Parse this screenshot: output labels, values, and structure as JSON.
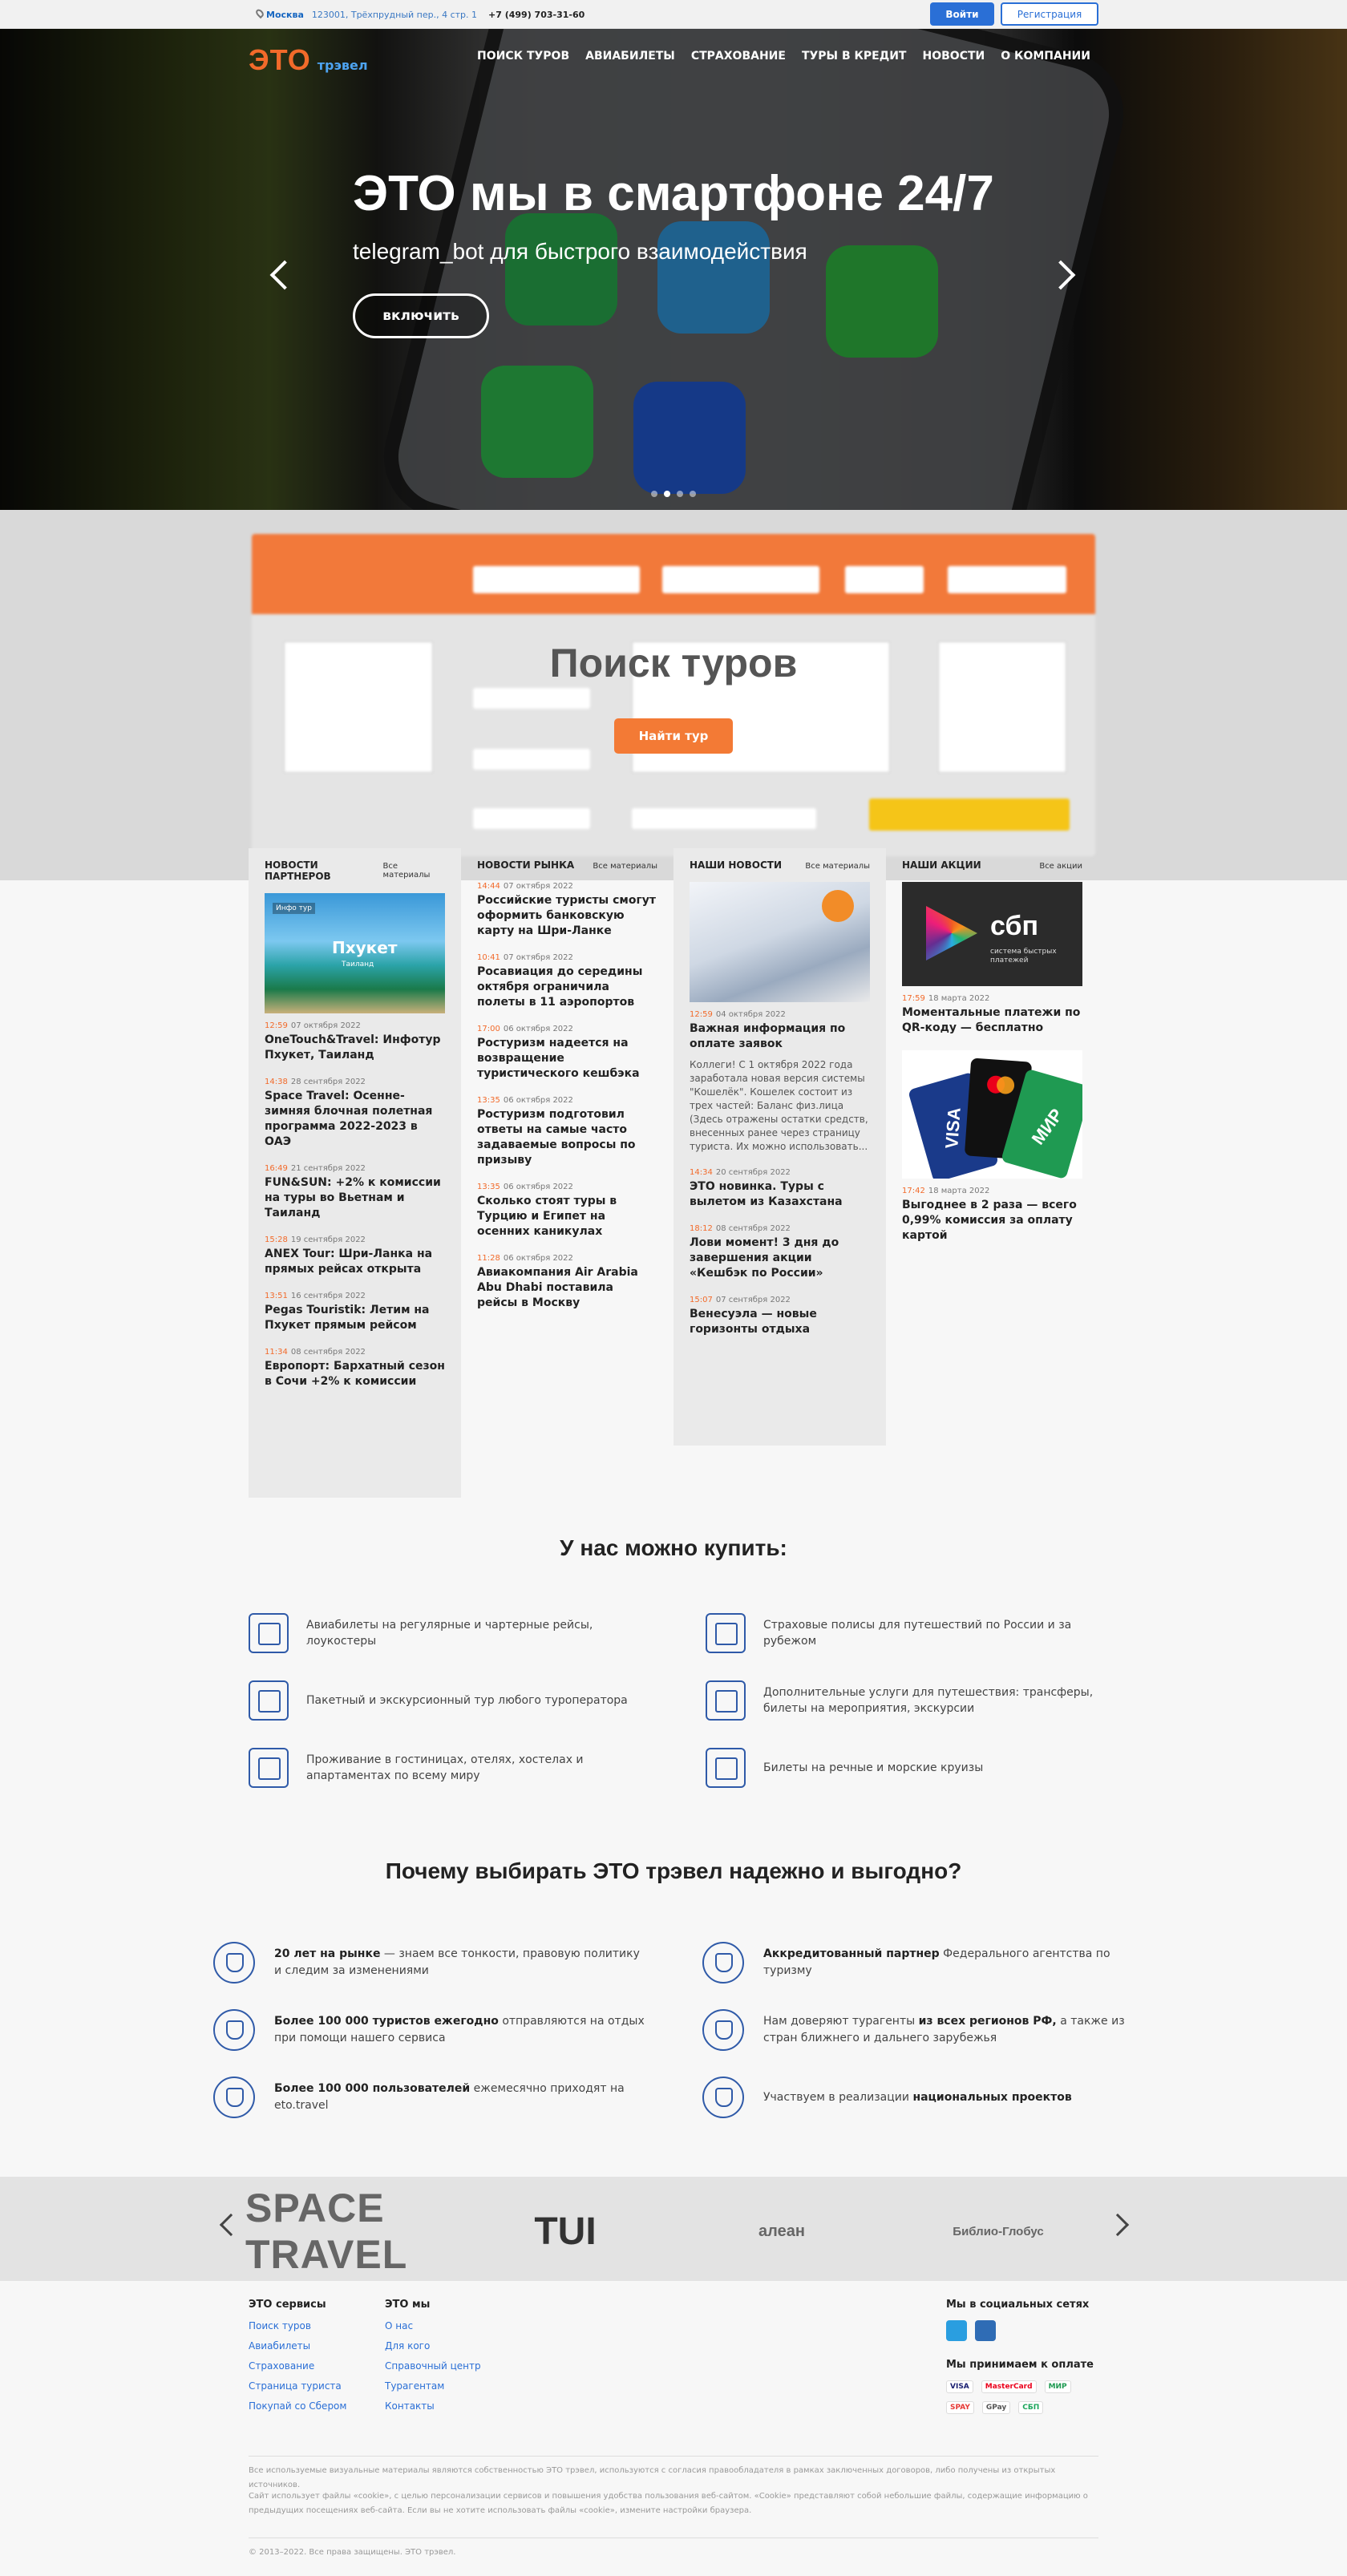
{
  "topbar": {
    "city": "Москва",
    "address": "123001, Трёхпрудный пер., 4 стр. 1",
    "phone": "+7 (499) 703-31-60",
    "login": "Войти",
    "register": "Регистрация"
  },
  "brand": {
    "eto": "ЭТО",
    "travel": "трэвел"
  },
  "nav": [
    "ПОИСК ТУРОВ",
    "АВИАБИЛЕТЫ",
    "СТРАХОВАНИЕ",
    "ТУРЫ В КРЕДИТ",
    "НОВОСТИ",
    "О КОМПАНИИ"
  ],
  "hero": {
    "title": "ЭТО мы в смартфоне 24/7",
    "subtitle": "telegram_bot для быстрого взаимодействия",
    "button": "включить",
    "slides": 4,
    "active_slide": 2
  },
  "search": {
    "title": "Поиск туров",
    "button": "Найти тур"
  },
  "news": {
    "partners": {
      "title": "НОВОСТИ ПАРТНЕРОВ",
      "all": "Все материалы",
      "image": {
        "tag": "Инфо тур",
        "title": "Пхукет",
        "sub": "Таиланд"
      },
      "items": [
        {
          "time": "12:59",
          "date": "07 октября 2022",
          "title": "OneTouch&Travel: Инфотур Пхукет, Таиланд"
        },
        {
          "time": "14:38",
          "date": "28 сентября 2022",
          "title": "Space Travel: Осенне-зимняя блочная полетная программа 2022-2023 в ОАЭ"
        },
        {
          "time": "16:49",
          "date": "21 сентября 2022",
          "title": "FUN&SUN: +2% к комиссии на туры во Вьетнам и Таиланд"
        },
        {
          "time": "15:28",
          "date": "19 сентября 2022",
          "title": "ANEX Tour: Шри-Ланка на прямых рейсах открыта"
        },
        {
          "time": "13:51",
          "date": "16 сентября 2022",
          "title": "Pegas Touristik: Летим на Пхукет прямым рейсом"
        },
        {
          "time": "11:34",
          "date": "08 сентября 2022",
          "title": "Европорт: Бархатный сезон в Сочи +2% к комиссии"
        }
      ]
    },
    "market": {
      "title": "НОВОСТИ РЫНКА",
      "all": "Все материалы",
      "items": [
        {
          "time": "14:44",
          "date": "07 октября 2022",
          "title": "Российские туристы смогут оформить банковскую карту на Шри-Ланке"
        },
        {
          "time": "10:41",
          "date": "07 октября 2022",
          "title": "Росавиация до середины октября ограничила полеты в 11 аэропортов"
        },
        {
          "time": "17:00",
          "date": "06 октября 2022",
          "title": "Ростуризм надеется на возвращение туристического кешбэка"
        },
        {
          "time": "13:35",
          "date": "06 октября 2022",
          "title": "Ростуризм подготовил ответы на самые часто задаваемые вопросы по призыву"
        },
        {
          "time": "13:35",
          "date": "06 октября 2022",
          "title": "Сколько стоят туры в Турцию и Египет на осенних каникулах"
        },
        {
          "time": "11:28",
          "date": "06 октября 2022",
          "title": "Авиакомпания Air Arabia Abu Dhabi поставила рейсы в Москву"
        }
      ]
    },
    "ours": {
      "title": "НАШИ НОВОСТИ",
      "all": "Все материалы",
      "items": [
        {
          "time": "12:59",
          "date": "04 октября 2022",
          "title": "Важная информация по оплате заявок",
          "text": "Коллеги! С 1 октября 2022 года заработала новая версия системы \"Кошелёк\". Кошелек состоит из трех частей: Баланс физ.лица (Здесь отражены остатки средств, внесенных ранее через страницу туриста. Их можно использовать..."
        },
        {
          "time": "14:34",
          "date": "20 сентября 2022",
          "title": "ЭТО новинка. Туры с вылетом из Казахстана"
        },
        {
          "time": "18:12",
          "date": "08 сентября 2022",
          "title": "Лови момент! 3 дня до завершения акции «Кешбэк по России»"
        },
        {
          "time": "15:07",
          "date": "07 сентября 2022",
          "title": "Венесуэла — новые горизонты отдыха"
        }
      ]
    },
    "promos": {
      "title": "НАШИ АКЦИИ",
      "all": "Все акции",
      "sbp": {
        "logo": "сбп",
        "caption": "система быстрых платежей"
      },
      "cards": {
        "visa": "VISA",
        "mir": "МИР"
      },
      "items": [
        {
          "time": "17:59",
          "date": "18 марта 2022",
          "title": "Моментальные платежи по QR-коду — бесплатно"
        },
        {
          "time": "17:42",
          "date": "18 марта 2022",
          "title": "Выгоднее в 2 раза — всего 0,99% комиссия за оплату картой"
        }
      ]
    }
  },
  "buy": {
    "title": "У нас можно купить:",
    "items": [
      {
        "icon": "plane-icon",
        "text": "Авиабилеты на регулярные и чартерные рейсы, лоукостеры"
      },
      {
        "icon": "insurance-icon",
        "text": "Страховые полисы для путешествий по России и за рубежом"
      },
      {
        "icon": "tour-package-icon",
        "text": "Пакетный и экскурсионный тур любого туроператора"
      },
      {
        "icon": "services-icon",
        "text": "Дополнительные услуги для путешествия: трансферы, билеты на мероприятия, экскурсии"
      },
      {
        "icon": "hotel-icon",
        "text": "Проживание в гостиницах, отелях, хостелах и апартаментах по всему миру"
      },
      {
        "icon": "cruise-ship-icon",
        "text": "Билеты на речные и морские круизы"
      }
    ]
  },
  "why": {
    "title": "Почему выбирать ЭТО трэвел надежно и выгодно?",
    "items": [
      {
        "bold": "20 лет на рынке",
        "text": " — знаем все тонкости, правовую политику и следим за изменениями"
      },
      {
        "bold": "Аккредитованный партнер",
        "text": " Федерального агентства по туризму"
      },
      {
        "bold": "Более 100 000 туристов ежегодно",
        "text": " отправляются на отдых при помощи нашего сервиса"
      },
      {
        "pre": "Нам доверяют турагенты ",
        "bold": "из всех регионов РФ,",
        "text": " а также из стран ближнего и дальнего зарубежья"
      },
      {
        "bold": "Более 100 000 пользователей",
        "text": " ежемесячно приходят на eto.travel"
      },
      {
        "pre": "Участвуем в реализации ",
        "bold": "национальных проектов",
        "text": ""
      }
    ]
  },
  "partners": [
    "SPACE TRAVEL",
    "TUI",
    "алеан",
    "Библио-Глобус"
  ],
  "footer": {
    "services": {
      "title": "ЭТО сервисы",
      "links": [
        "Поиск туров",
        "Авиабилеты",
        "Страхование",
        "Страница туриста",
        "Покупай со Сбером"
      ]
    },
    "we": {
      "title": "ЭТО мы",
      "links": [
        "О нас",
        "Для кого",
        "Справочный центр",
        "Турагентам",
        "Контакты"
      ]
    },
    "social_title": "Мы в социальных сетях",
    "pay_title": "Мы принимаем к оплате",
    "pay": [
      "VISA",
      "MasterCard",
      "МИР",
      "SPAY",
      "GPay",
      "СБП"
    ],
    "note1": "Все используемые визуальные материалы являются собственностью ЭТО трэвел, используются с согласия правообладателя в рамках заключенных договоров, либо получены из открытых источников.",
    "note2": "Сайт использует файлы «cookie», с целью персонализации сервисов и повышения удобства пользования веб-сайтом. «Cookie» представляют собой небольшие файлы, содержащие информацию о предыдущих посещениях веб-сайта. Если вы не хотите использовать файлы «cookie», измените настройки браузера.",
    "copyright": "© 2013–2022. Все права защищены. ЭТО трэвел."
  }
}
